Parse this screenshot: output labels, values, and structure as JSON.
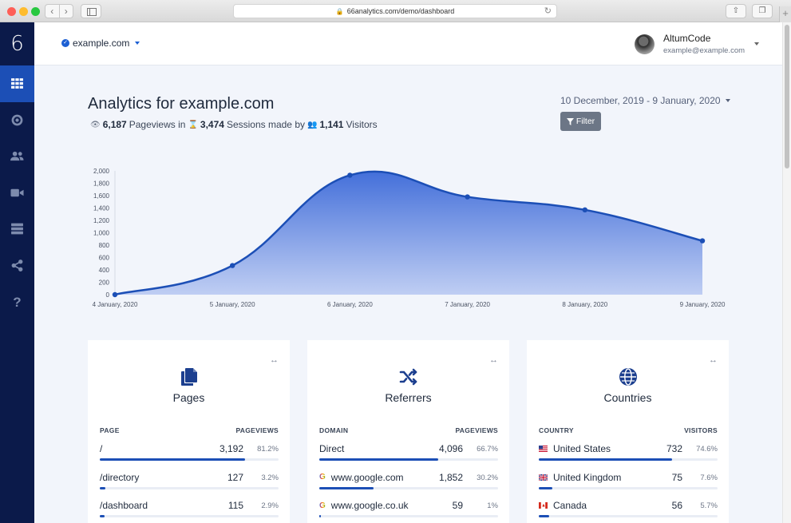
{
  "browser": {
    "url": "66analytics.com/demo/dashboard",
    "back_icon": "chevron-left-icon",
    "forward_icon": "chevron-right-icon",
    "reload_icon": "reload-icon",
    "share_icon": "share-icon",
    "tabs_icon": "tabs-icon"
  },
  "sidebar": {
    "logo": "6",
    "items": [
      {
        "icon": "grid-icon",
        "active": true
      },
      {
        "icon": "target-icon",
        "active": false
      },
      {
        "icon": "users-icon",
        "active": false
      },
      {
        "icon": "video-icon",
        "active": false
      },
      {
        "icon": "server-icon",
        "active": false
      },
      {
        "icon": "share-nodes-icon",
        "active": false
      },
      {
        "icon": "question-icon",
        "active": false
      }
    ]
  },
  "header": {
    "site": "example.com",
    "user_name": "AltumCode",
    "user_email": "example@example.com"
  },
  "overview": {
    "title": "Analytics for example.com",
    "pageviews": "6,187",
    "pageviews_label": "Pageviews in",
    "sessions": "3,474",
    "sessions_label": "Sessions made by",
    "visitors": "1,141",
    "visitors_label": "Visitors",
    "date_range": "10 December, 2019 - 9 January, 2020",
    "filter_label": "Filter"
  },
  "chart_data": {
    "type": "area",
    "x": [
      "4 January, 2020",
      "5 January, 2020",
      "6 January, 2020",
      "7 January, 2020",
      "8 January, 2020",
      "9 January, 2020"
    ],
    "series": [
      {
        "values": [
          0,
          470,
          1930,
          1580,
          1370,
          870
        ]
      }
    ],
    "ylim": [
      0,
      2000
    ],
    "yticks": [
      "0",
      "200",
      "400",
      "600",
      "800",
      "1,000",
      "1,200",
      "1,400",
      "1,600",
      "1,800",
      "2,000"
    ],
    "color": "#1c4fb6",
    "grid": false
  },
  "cards": [
    {
      "icon": "copy-files-icon",
      "title": "Pages",
      "col1": "PAGE",
      "col2": "PAGEVIEWS",
      "rows": [
        {
          "label": "/",
          "value": "3,192",
          "pct": "81.2%",
          "fraction": 0.812
        },
        {
          "label": "/directory",
          "value": "127",
          "pct": "3.2%",
          "fraction": 0.032
        },
        {
          "label": "/dashboard",
          "value": "115",
          "pct": "2.9%",
          "fraction": 0.029
        }
      ]
    },
    {
      "icon": "shuffle-icon",
      "title": "Referrers",
      "col1": "DOMAIN",
      "col2": "PAGEVIEWS",
      "rows": [
        {
          "label": "Direct",
          "value": "4,096",
          "pct": "66.7%",
          "fraction": 0.667
        },
        {
          "label": "www.google.com",
          "value": "1,852",
          "pct": "30.2%",
          "fraction": 0.302,
          "icon": "google-icon",
          "icon_text": "G"
        },
        {
          "label": "www.google.co.uk",
          "value": "59",
          "pct": "1%",
          "fraction": 0.01,
          "icon": "google-icon",
          "icon_text": "G"
        }
      ]
    },
    {
      "icon": "globe-icon",
      "title": "Countries",
      "col1": "COUNTRY",
      "col2": "VISITORS",
      "rows": [
        {
          "label": "United States",
          "value": "732",
          "pct": "74.6%",
          "fraction": 0.746,
          "icon": "flag-us-icon"
        },
        {
          "label": "United Kingdom",
          "value": "75",
          "pct": "7.6%",
          "fraction": 0.076,
          "icon": "flag-uk-icon"
        },
        {
          "label": "Canada",
          "value": "56",
          "pct": "5.7%",
          "fraction": 0.057,
          "icon": "flag-ca-icon"
        }
      ]
    }
  ]
}
